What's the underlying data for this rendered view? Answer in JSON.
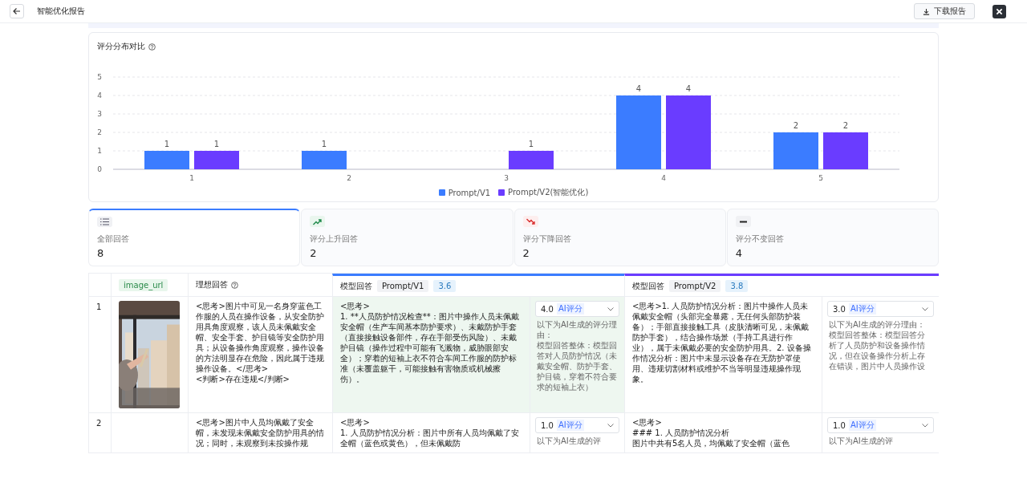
{
  "header": {
    "title": "智能优化报告",
    "download_button": "下载报告"
  },
  "chart_card": {
    "title": "评分分布对比",
    "chart_data": {
      "type": "bar",
      "categories": [
        "1",
        "2",
        "3",
        "4",
        "5"
      ],
      "series": [
        {
          "name": "Prompt/V1",
          "color": "#3b7cff",
          "values": [
            1,
            1,
            null,
            4,
            2
          ]
        },
        {
          "name": "Prompt/V2(智能优化)",
          "color": "#6a3cff",
          "values": [
            1,
            null,
            1,
            4,
            2
          ]
        }
      ],
      "ylim": [
        0,
        5
      ],
      "yticks": [
        0,
        1,
        2,
        3,
        4,
        5
      ],
      "grid": true,
      "data_labels": true
    }
  },
  "stats": [
    {
      "kind": "all",
      "label": "全部回答",
      "value": "8",
      "selected": true
    },
    {
      "kind": "up",
      "label": "评分上升回答",
      "value": "2",
      "selected": false
    },
    {
      "kind": "down",
      "label": "评分下降回答",
      "value": "2",
      "selected": false
    },
    {
      "kind": "same",
      "label": "评分不变回答",
      "value": "4",
      "selected": false
    }
  ],
  "table": {
    "image_column": "image_url",
    "ideal_column": "理想回答",
    "models": [
      {
        "label": "模型回答",
        "prompt": "Prompt/V1",
        "score": "3.6",
        "color": "#3b7cff"
      },
      {
        "label": "模型回答",
        "prompt": "Prompt/V2",
        "score": "3.8",
        "color": "#6a3cff"
      }
    ],
    "rows": [
      {
        "index": "1",
        "image": {
          "kind": "picture"
        },
        "ideal": [
          "<思考>图片中可见一名身穿蓝色工作服的人员在操作设备，从安全防护用具角度观察，该人员未佩戴安全帽、安全手套、护目镜等安全防护用具；从设备操作角度观察，操作设备的方法明显存在危险，因此属于违规操作设备。</思考>",
          "<判断>存在违规</判断>"
        ],
        "answers": [
          {
            "highlighted": true,
            "text": [
              "<思考>",
              "1. **人员防护情况检查**：图片中操作人员未佩戴安全帽（生产车间基本防护要求）、未戴防护手套（直接接触设备部件，存在手部受伤风险）、未戴护目镜（操作过程中可能有飞溅物，威胁眼部安全）；穿着的短袖上衣不符合车间工作服的防护标准（未覆盖躯干，可能接触有害物质或机械擦伤）。"
            ],
            "score": "4.0",
            "score_tag": "AI评分",
            "reason": [
              "以下为AI生成的评分理由：",
              "模型回答整体：模型回答对人员防护情况（未戴安全帽、防护手套、护目镜，穿着不符合要求的短袖上衣）"
            ]
          },
          {
            "highlighted": false,
            "text": [
              "<思考>1. 人员防护情况分析：图片中操作人员未佩戴安全帽（头部完全暴露，无任何头部防护装备）；手部直接接触工具（皮肤清晰可见，未佩戴防护手套），结合操作场景（手持工具进行作业），属于未佩戴必要的安全防护用具。2. 设备操作情况分析：图片中未显示设备存在无防护罩使用、违规切割材料或维护不当等明显违规操作现象。"
            ],
            "score": "3.0",
            "score_tag": "AI评分",
            "reason": [
              "以下为AI生成的评分理由：",
              "模型回答整体：模型回答分析了人员防护和设备操作情况，但在设备操作分析上存在错误，图片中人员操作设"
            ]
          }
        ]
      },
      {
        "index": "2",
        "ideal": [
          "<思考>图片中人员均佩戴了安全帽，未发现未佩戴安全防护用具的情况；同时，未观察到未按操作规"
        ],
        "answers": [
          {
            "highlighted": false,
            "text": [
              "<思考>",
              "1. 人员防护情况分析：图片中所有人员均佩戴了安全帽（蓝色或黄色），但未佩戴防"
            ],
            "score": "1.0",
            "score_tag": "AI评分",
            "reason": [
              "以下为AI生成的评"
            ]
          },
          {
            "highlighted": false,
            "text": [
              "<思考>",
              "### 1. 人员防护情况分析",
              "图片中共有5名人员，均佩戴了安全帽（蓝色"
            ],
            "score": "1.0",
            "score_tag": "AI评分",
            "reason": [
              "以下为AI生成的评"
            ]
          }
        ]
      }
    ]
  }
}
